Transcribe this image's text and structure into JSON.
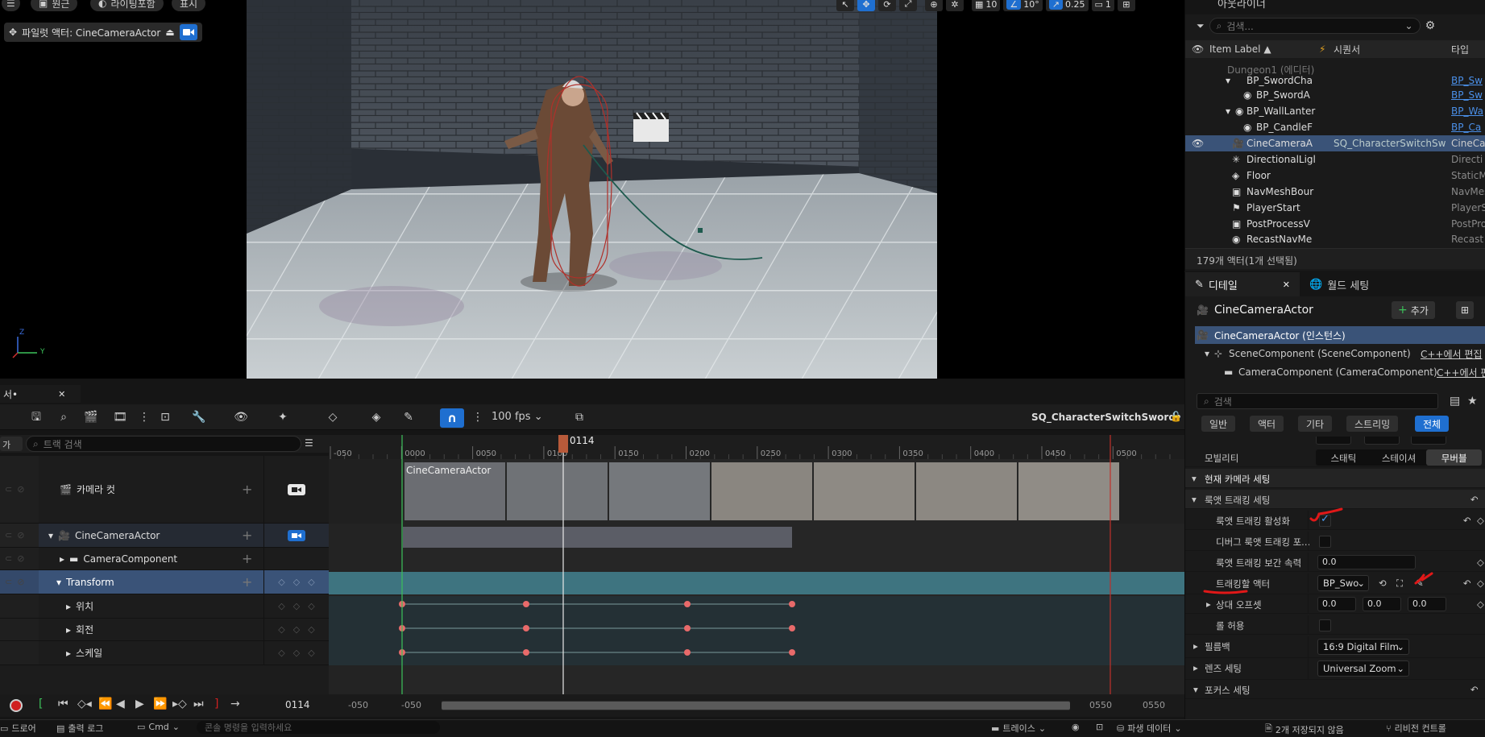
{
  "viewport": {
    "menu_label": "원근",
    "lighting_label": "라이팅포함",
    "show_label": "표시",
    "pilot_label": "파일럿 액터: CineCameraActor",
    "grid_snap": "10",
    "rot_snap": "10°",
    "scale_snap": "0.25",
    "cam_speed": "1",
    "axis_z": "Z",
    "axis_y": "Y"
  },
  "outliner": {
    "tab_title": "아웃라이너",
    "search_placeholder": "검색...",
    "col_item_label": "Item Label ▲",
    "col_sequencer": "시퀀서",
    "col_type": "타입",
    "rows": [
      {
        "name": "Dungeon1 (에디터)",
        "seq": "",
        "type": ""
      },
      {
        "name": "BP_SwordCha",
        "seq": "",
        "type": "BP_Sw"
      },
      {
        "name": "BP_SwordA",
        "seq": "",
        "type": "BP_Sw"
      },
      {
        "name": "BP_WallLanter",
        "seq": "",
        "type": "BP_Wa"
      },
      {
        "name": "BP_CandleF",
        "seq": "",
        "type": "BP_Ca"
      },
      {
        "name": "CineCameraA",
        "seq": "SQ_CharacterSwitchSw",
        "type": "CineCa"
      },
      {
        "name": "DirectionalLigl",
        "seq": "",
        "type": "Directi"
      },
      {
        "name": "Floor",
        "seq": "",
        "type": "StaticM"
      },
      {
        "name": "NavMeshBour",
        "seq": "",
        "type": "NavMes"
      },
      {
        "name": "PlayerStart",
        "seq": "",
        "type": "PlayerS"
      },
      {
        "name": "PostProcessV",
        "seq": "",
        "type": "PostPro"
      },
      {
        "name": "RecastNavMe",
        "seq": "",
        "type": "Recast"
      }
    ],
    "count_text": "179개 액터(1개 선택됨)"
  },
  "details": {
    "tab_details": "디테일",
    "tab_world": "월드 세팅",
    "actor_name": "CineCameraActor",
    "add_label": "추가",
    "instance_label": "CineCameraActor (인스턴스)",
    "scene_component": "SceneComponent (SceneComponent)",
    "scene_edit": "C++에서 편집",
    "camera_component": "CameraComponent (CameraComponent)",
    "camera_edit": "C++에서 편",
    "search_placeholder": "검색",
    "filters": [
      "일반",
      "액터",
      "기타",
      "스트리밍",
      "전체"
    ],
    "mobility_label": "모빌리티",
    "mobility_options": [
      "스태틱",
      "스테이셔",
      "무버블"
    ],
    "section_current_camera": "현재 카메라 세팅",
    "section_lookat": "룩앳 트래킹 세팅",
    "prop_enable_lookat": "룩앳 트래킹 활성화",
    "prop_debug_lookat": "디버그 룩앳 트래킹 포...",
    "prop_interp_speed": "룩앳 트래킹 보간 속력",
    "interp_speed_value": "0.0",
    "prop_actor_to_track": "트래킹할 액터",
    "actor_to_track_value": "BP_Swo",
    "prop_relative_offset": "상대 오프셋",
    "offset_x": "0.0",
    "offset_y": "0.0",
    "offset_z": "0.0",
    "prop_allow_roll": "롤 허용",
    "prop_filmback": "필름백",
    "filmback_value": "16:9 Digital Film",
    "prop_lens": "렌즈 세팅",
    "lens_value": "Universal Zoom",
    "prop_focus": "포커스 세팅"
  },
  "sequencer": {
    "tab_title": "서•",
    "fps_label": "100 fps",
    "sequence_name": "SQ_CharacterSwitchSword•",
    "add_track_label": "가",
    "search_placeholder": "트랙 검색",
    "playhead_frame": "0114",
    "ruler_ticks": [
      "-050",
      "0000",
      "0050",
      "0100",
      "0150",
      "0200",
      "0250",
      "0300",
      "0350",
      "0400",
      "0450",
      "0500"
    ],
    "shot_label": "CineCameraActor",
    "tracks": [
      {
        "label": "카메라 컷",
        "kind": "camera-cut"
      },
      {
        "label": "CineCameraActor",
        "kind": "actor"
      },
      {
        "label": "CameraComponent",
        "kind": "component"
      },
      {
        "label": "Transform",
        "kind": "transform"
      },
      {
        "label": "위치",
        "kind": "channel"
      },
      {
        "label": "회전",
        "kind": "channel"
      },
      {
        "label": "스케일",
        "kind": "channel"
      }
    ],
    "transport_frame": "0114",
    "range_start": "-050",
    "range_start2": "-050",
    "range_end": "0550",
    "range_end2": "0550"
  },
  "statusbar": {
    "drawer": "드로어",
    "output_log": "출력 로그",
    "cmd": "Cmd",
    "console_placeholder": "콘솔 명령을 입력하세요",
    "trace": "트레이스",
    "derived_data": "파생 데이터",
    "unsaved": "2개 저장되지 않음",
    "revision": "리비전 컨트롤"
  },
  "colors": {
    "accent_blue": "#1f6fd0",
    "selection_row": "#3a5378",
    "transform_teal": "#3e7480",
    "playhead": "#b85a3a",
    "annotation_red": "#e01818"
  }
}
